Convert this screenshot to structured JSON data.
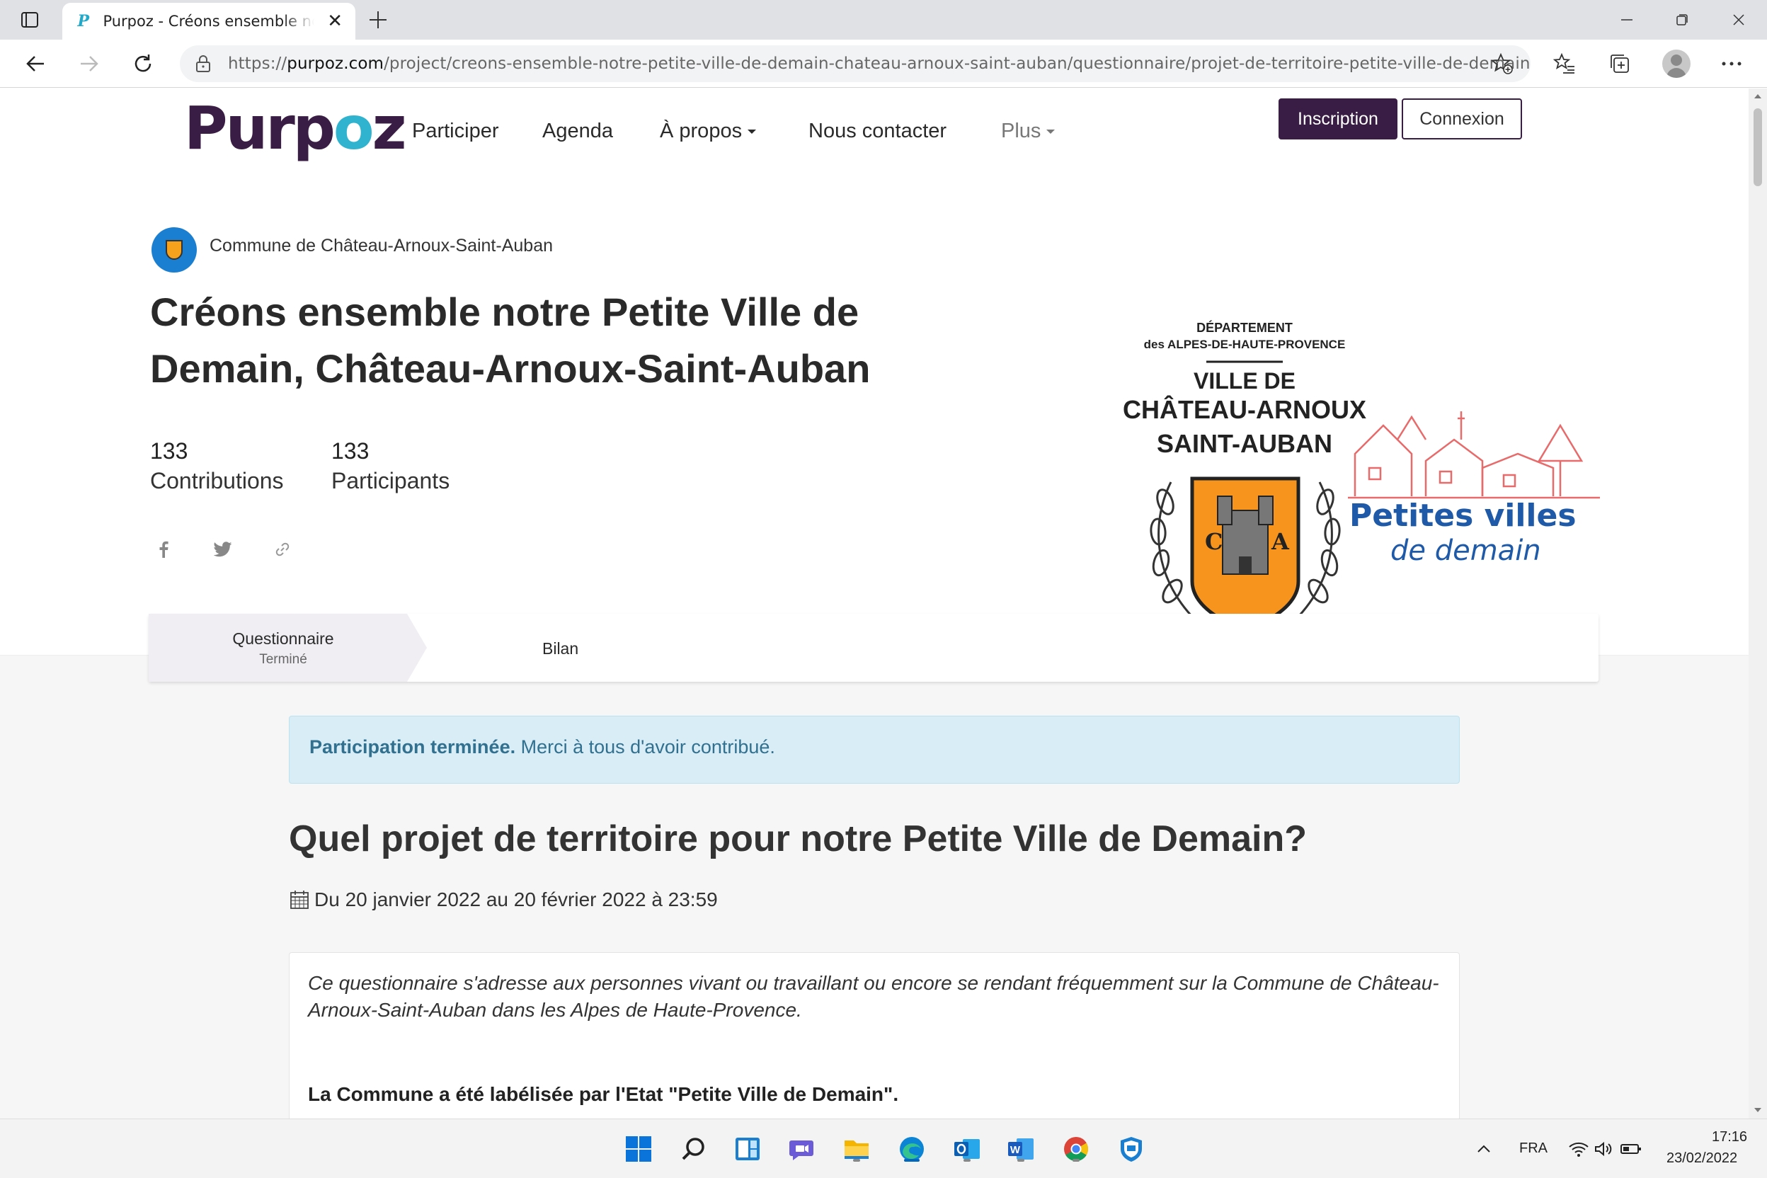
{
  "browser": {
    "tab_title": "Purpoz - Créons ensemble notre Petite Ville de Demain",
    "tab_favicon": "P",
    "url_prefix": "https://",
    "url_domain": "purpoz.com",
    "url_path": "/project/creons-ensemble-notre-petite-ville-de-demain-chateau-arnoux-saint-auban/questionnaire/projet-de-territoire-petite-ville-de-demain",
    "icons": [
      "tab-actions-icon",
      "close-icon",
      "plus-icon",
      "minimize-icon",
      "restore-icon",
      "close-window-icon",
      "back-icon",
      "forward-icon",
      "refresh-icon",
      "lock-icon",
      "add-favorite-icon",
      "favorites-icon",
      "collections-icon",
      "profile-icon",
      "more-icon"
    ]
  },
  "site": {
    "logo_pre": "Purp",
    "logo_o": "o",
    "logo_post": "z",
    "nav": {
      "participer": "Participer",
      "agenda": "Agenda",
      "apropos": "À propos",
      "contact": "Nous contacter",
      "plus": "Plus"
    },
    "inscription": "Inscription",
    "connexion": "Connexion",
    "brand_color": "#3a1d44",
    "accent_color": "#2fb3cf"
  },
  "project": {
    "org_name": "Commune de Château-Arnoux-Saint-Auban",
    "title": "Créons ensemble notre Petite Ville de Demain, Château-Arnoux-Saint-Auban",
    "contributions_count": "133",
    "contributions_label": "Contributions",
    "participants_count": "133",
    "participants_label": "Participants"
  },
  "banner": {
    "dept_line1": "DÉPARTEMENT",
    "dept_line2": "des ALPES-DE-HAUTE-PROVENCE",
    "ville_de": "VILLE DE",
    "city_line1": "CHÂTEAU-ARNOUX",
    "city_line2": "SAINT-AUBAN",
    "shield_left": "C",
    "shield_right": "A",
    "pvd_line1": "Petites villes",
    "pvd_line2": "de demain"
  },
  "steps": [
    {
      "title": "Questionnaire",
      "status": "Terminé"
    },
    {
      "title": "Bilan"
    }
  ],
  "alert": {
    "strong": "Participation terminée.",
    "text": " Merci à tous d'avoir contribué."
  },
  "questionnaire": {
    "title": "Quel projet de territoire pour notre Petite Ville de Demain?",
    "dates": "Du 20 janvier 2022 au 20 février 2022 à 23:59",
    "description": "Ce questionnaire s'adresse aux personnes vivant ou travaillant ou encore se rendant fréquemment sur la Commune de Château-Arnoux-Saint-Auban dans les Alpes de Haute-Provence.",
    "label_statement": "La Commune a été labélisée par l'Etat \"Petite Ville de Demain\"."
  },
  "taskbar": {
    "apps": [
      "start-icon",
      "search-icon",
      "widgets-icon",
      "chat-icon",
      "file-explorer-icon",
      "edge-icon",
      "outlook-icon",
      "word-icon",
      "chrome-icon",
      "security-icon"
    ],
    "language": "FRA",
    "time": "17:16",
    "date": "23/02/2022"
  }
}
